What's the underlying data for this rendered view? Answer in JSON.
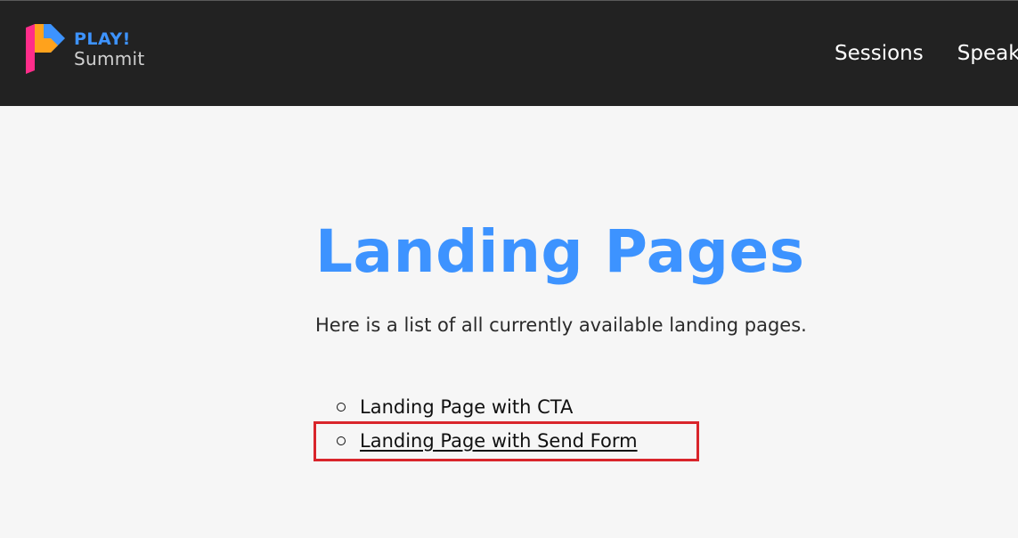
{
  "header": {
    "logo": {
      "line1": "PLAY!",
      "line2": "Summit",
      "colors": {
        "blue": "#3d93ff",
        "pink": "#ff2d8a",
        "orange": "#ffa21c"
      }
    },
    "nav": [
      {
        "label": "Sessions"
      },
      {
        "label": "Speakers"
      }
    ]
  },
  "main": {
    "title": "Landing Pages",
    "intro": "Here is a list of all currently available landing pages.",
    "links": [
      {
        "label": "Landing Page with CTA",
        "underlined": false
      },
      {
        "label": "Landing Page with Send Form",
        "underlined": true,
        "highlighted": true
      }
    ]
  },
  "colors": {
    "header_bg": "#222222",
    "page_bg": "#f6f6f6",
    "accent": "#3d93ff",
    "highlight": "#d9252b"
  }
}
